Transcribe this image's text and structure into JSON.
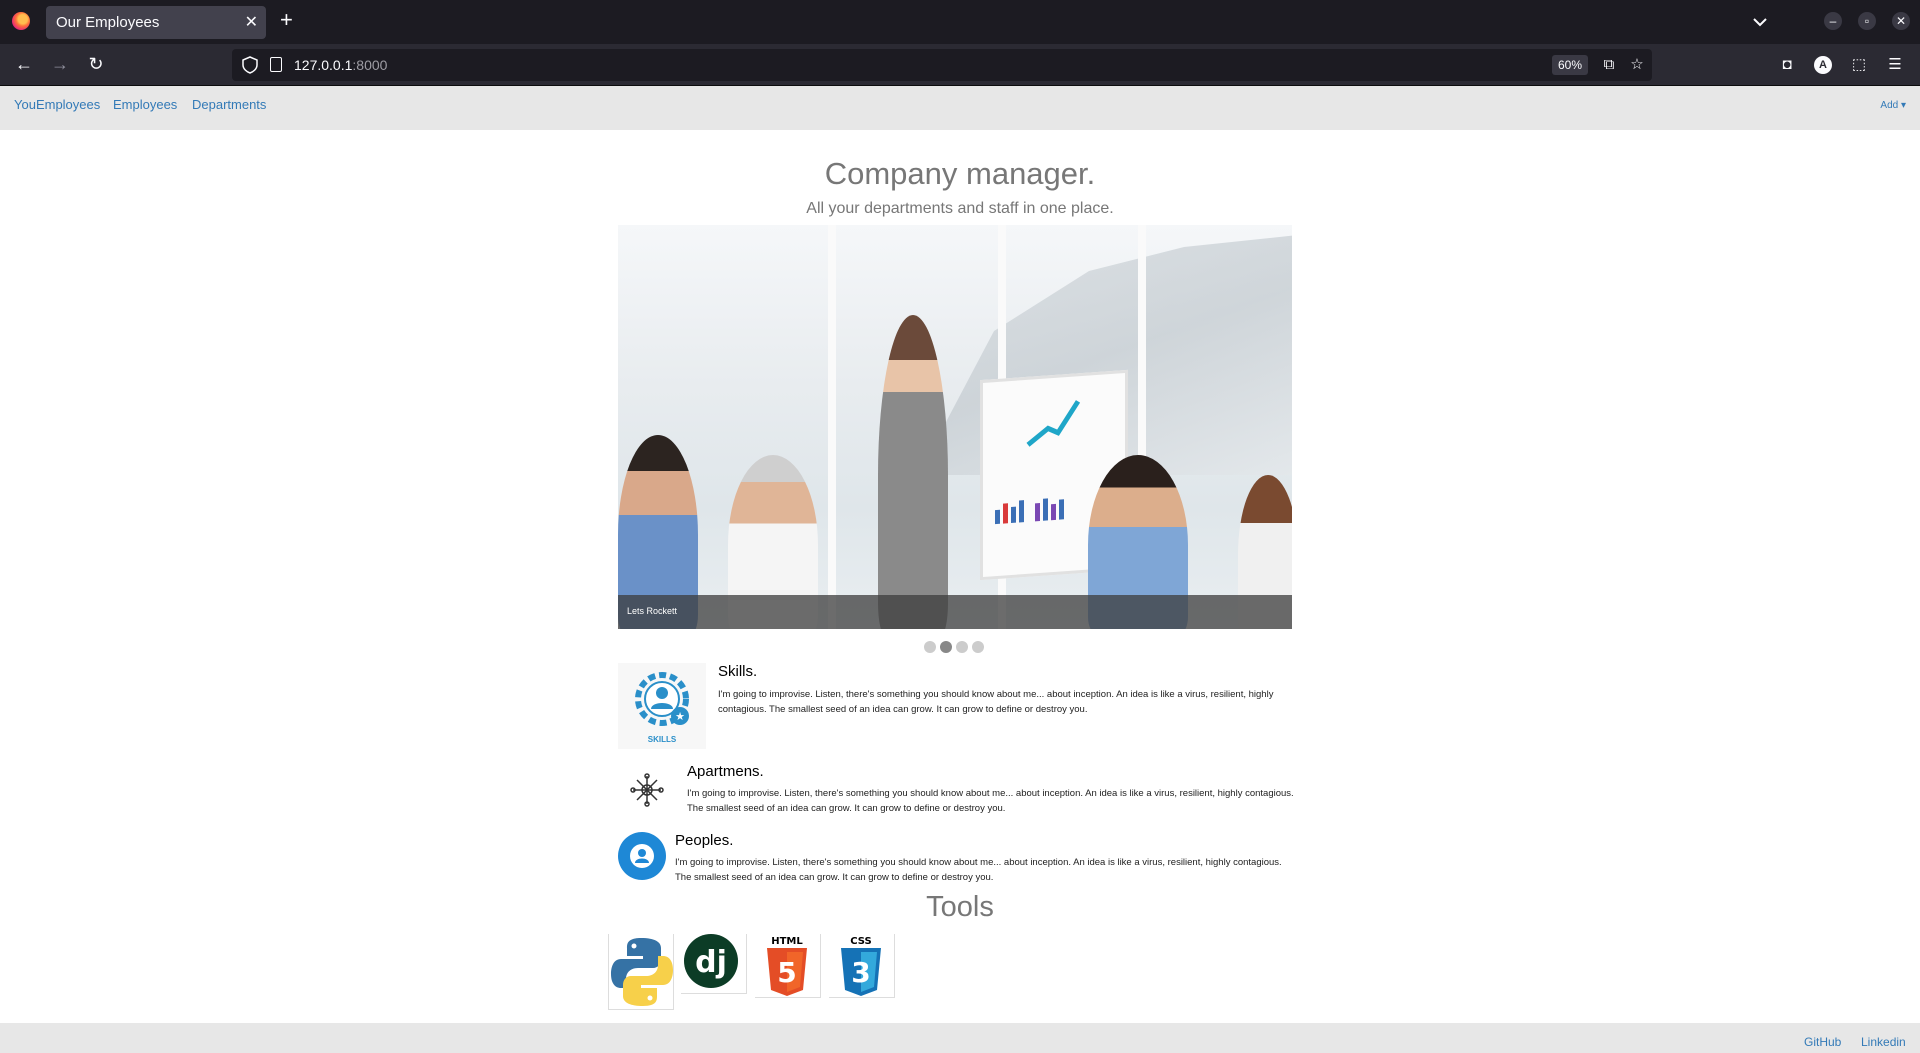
{
  "browser": {
    "tab_title": "Our Employees",
    "url_host": "127.0.0.1",
    "url_port": ":8000",
    "zoom": "60%"
  },
  "nav": {
    "brand": "YouEmployees",
    "links": [
      "Employees",
      "Departments"
    ],
    "add_label": "Add ▾"
  },
  "hero": {
    "title": "Company manager.",
    "subtitle": "All your departments and staff in one place."
  },
  "carousel": {
    "caption": "Lets Rockett",
    "slides": 4,
    "active_slide": 2
  },
  "features": [
    {
      "title": "Skills.",
      "icon": "skills-gear-icon",
      "icon_label": "SKILLS",
      "text_line1": "I'm going to improvise. Listen, there's something you should know about me... about inception. An idea is like a virus, resilient, highly",
      "text_line2": "contagious. The smallest seed of an idea can grow. It can grow to define or destroy you."
    },
    {
      "title": "Apartmens.",
      "icon": "network-icon",
      "text_line1": "I'm going to improvise. Listen, there's something you should know about me... about inception. An idea is like a virus, resilient, highly contagious.",
      "text_line2": "The smallest seed of an idea can grow. It can grow to define or destroy you."
    },
    {
      "title": "Peoples.",
      "icon": "person-icon",
      "text_line1": "I'm going to improvise. Listen, there's something you should know about me... about inception. An idea is like a virus, resilient, highly contagious.",
      "text_line2": "The smallest seed of an idea can grow. It can grow to define or destroy you."
    }
  ],
  "tools": {
    "title": "Tools",
    "items": [
      {
        "name": "python-logo",
        "label": ""
      },
      {
        "name": "django-logo",
        "label": "dj"
      },
      {
        "name": "html5-logo",
        "label": "HTML"
      },
      {
        "name": "css3-logo",
        "label": "CSS"
      }
    ]
  },
  "footer": {
    "links": [
      "GitHub",
      "Linkedin"
    ]
  },
  "colors": {
    "link": "#337ab7",
    "nav_bg": "#e7e7e7",
    "muted_text": "#777777"
  }
}
